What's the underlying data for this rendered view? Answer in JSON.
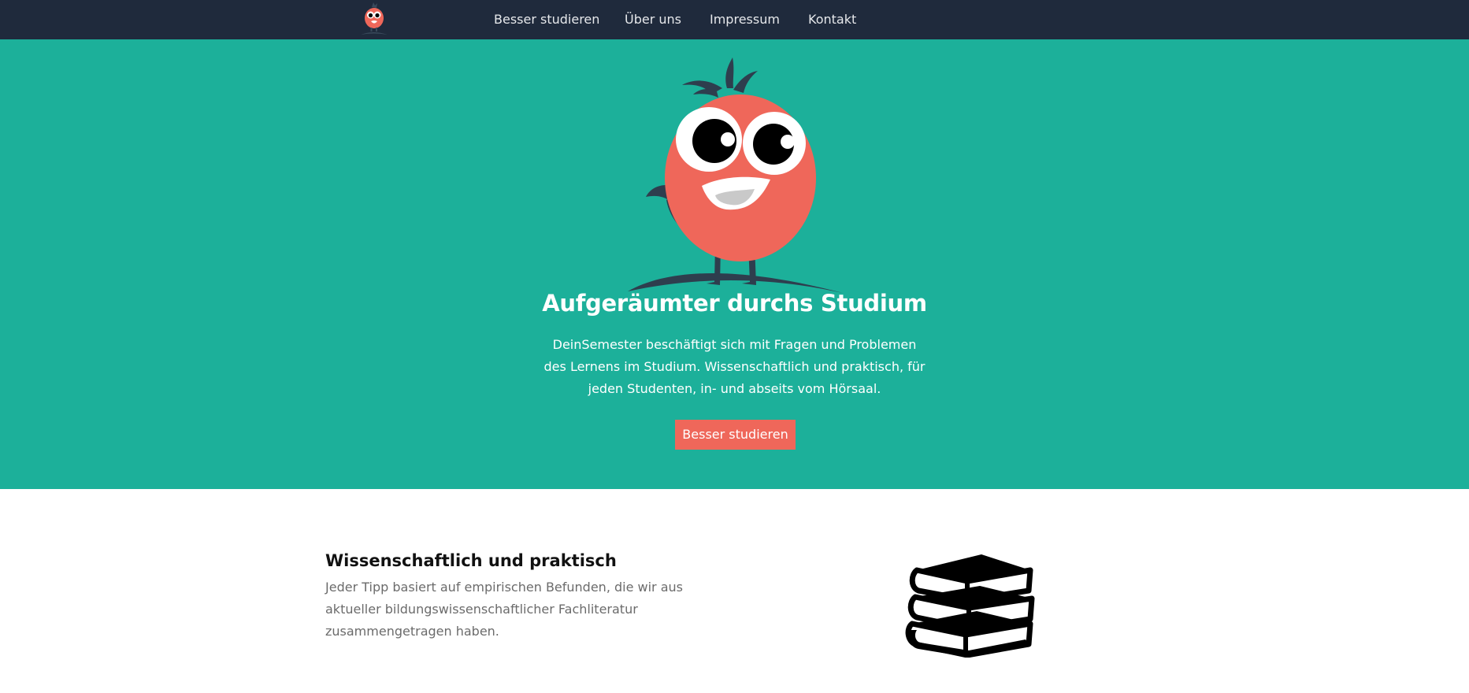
{
  "nav": {
    "logo_icon": "mascot-logo-icon",
    "links": [
      "Besser studieren",
      "Über uns",
      "Impressum",
      "Kontakt"
    ]
  },
  "hero": {
    "illustration": "mascot-illustration",
    "title": "Aufgeräumter durchs Studium",
    "text": "DeinSemester beschäftigt sich mit Fragen und Problemen des Lernens im Studium. Wissenschaftlich und praktisch, für jeden Studenten, in- und abseits vom Hörsaal.",
    "button_label": "Besser studieren"
  },
  "feature": {
    "title": "Wissenschaftlich und praktisch",
    "text": "Jeder Tipp basiert auf empirischen Befunden, die wir aus aktueller bildungswissenschaftlicher Fachliteratur zusammengetragen haben.",
    "icon": "books-icon"
  },
  "colors": {
    "navbar": "#1f2a3c",
    "hero_bg": "#1cb09a",
    "accent": "#ef675a",
    "mascot_body": "#ef675a",
    "dark_detail": "#2e3e4e"
  }
}
